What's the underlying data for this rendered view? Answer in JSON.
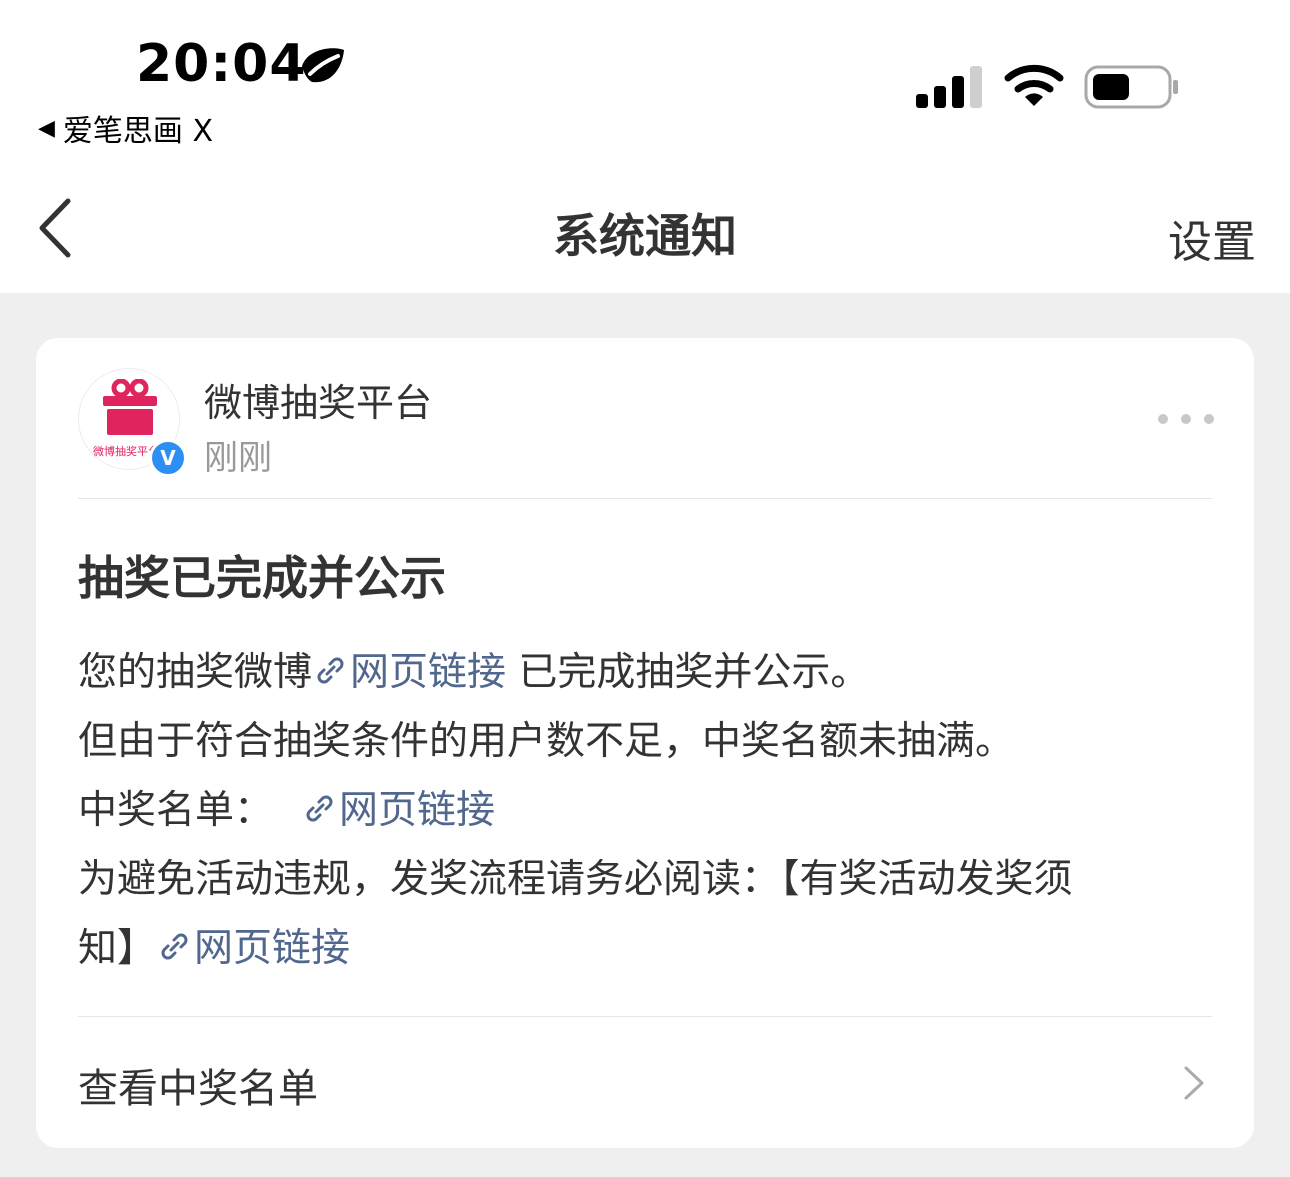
{
  "status_bar": {
    "time": "20:04",
    "back_app_label": "爱笔思画 X"
  },
  "nav": {
    "title": "系统通知",
    "settings_label": "设置"
  },
  "message": {
    "sender_name": "微博抽奖平台",
    "sender_time": "刚刚",
    "avatar_caption": "微博抽奖平台",
    "verified_mark": "V",
    "title": "抽奖已完成并公示",
    "line1_prefix": "您的抽奖微博",
    "line1_link": "网页链接",
    "line1_suffix": " 已完成抽奖并公示。",
    "line2": "但由于符合抽奖条件的用户数不足，中奖名额未抽满。",
    "line3_prefix": "中奖名单：",
    "line3_link": "网页链接",
    "line4": "为避免活动违规，发奖流程请务必阅读：【有奖活动发奖须",
    "line5_prefix": "知】",
    "line5_link": "网页链接",
    "footer_action": "查看中奖名单"
  },
  "colors": {
    "link": "#51678d",
    "verified_badge": "#2b8ff3",
    "gift_brand": "#e0245e",
    "page_background": "#efeff0"
  }
}
